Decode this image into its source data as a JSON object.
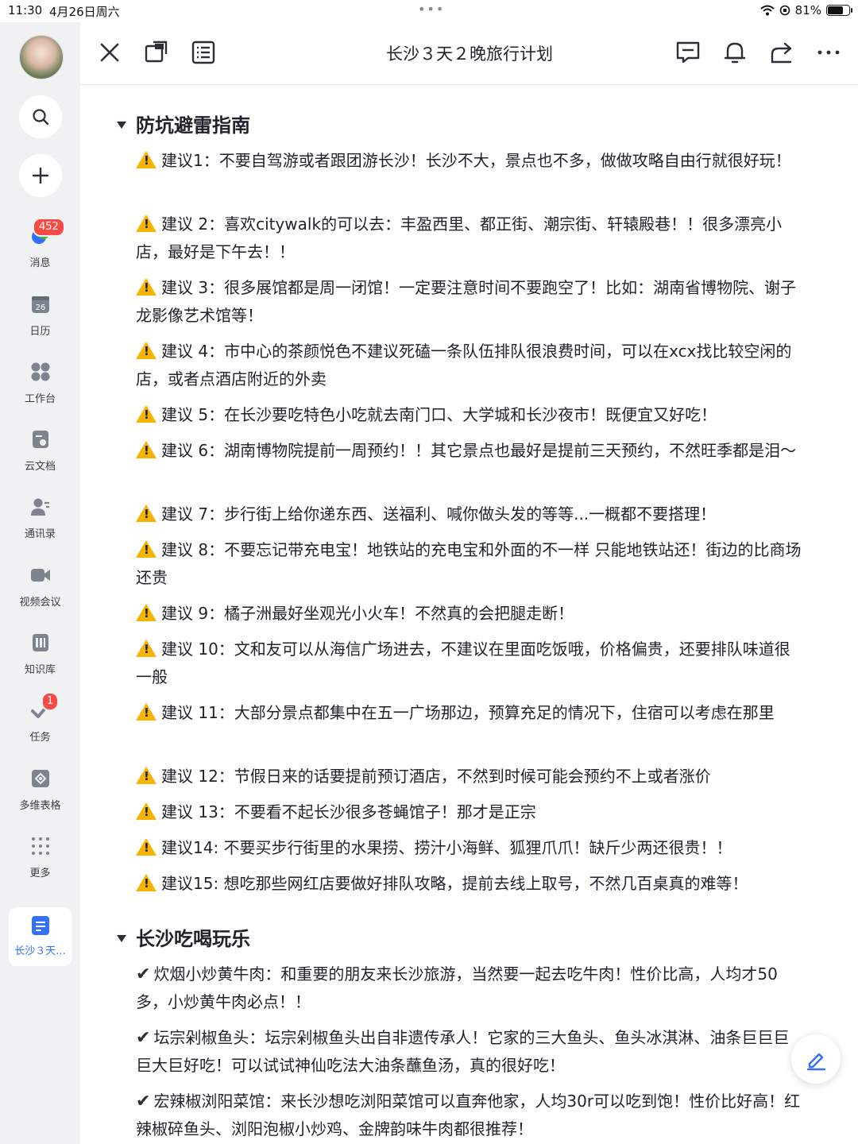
{
  "status_bar": {
    "time": "11:30",
    "date": "4月26日周六",
    "battery": "81%",
    "battery_level": 0.81
  },
  "sidebar": {
    "search_icon": "search-icon",
    "add_icon": "plus-icon",
    "items": [
      {
        "label": "消息",
        "icon": "message-icon",
        "badge": "452"
      },
      {
        "label": "日历",
        "icon": "calendar-icon",
        "icon_text": "26"
      },
      {
        "label": "工作台",
        "icon": "workspace-icon"
      },
      {
        "label": "云文档",
        "icon": "cloud-doc-icon"
      },
      {
        "label": "通讯录",
        "icon": "contacts-icon"
      },
      {
        "label": "视频会议",
        "icon": "video-icon"
      },
      {
        "label": "知识库",
        "icon": "wiki-icon"
      },
      {
        "label": "任务",
        "icon": "task-icon",
        "badge": "1"
      },
      {
        "label": "多维表格",
        "icon": "base-icon"
      },
      {
        "label": "更多",
        "icon": "more-grid-icon"
      }
    ],
    "active_doc_label": "长沙３天..."
  },
  "header": {
    "title": "长沙３天２晚旅行计划"
  },
  "sections": [
    {
      "heading": "防坑避雷指南",
      "paragraphs": [
        "建议1：不要自驾游或者跟团游长沙！长沙不大，景点也不多，做做攻略自由行就很好玩！",
        "建议 2：喜欢citywalk的可以去：丰盈西里、都正街、潮宗街、轩辕殿巷！！很多漂亮小店，最好是下午去！！",
        "建议 3：很多展馆都是周一闭馆！一定要注意时间不要跑空了！比如：湖南省博物院、谢子龙影像艺术馆等！",
        "建议 4：市中心的茶颜悦色不建议死磕一条队伍排队很浪费时间，可以在xcx找比较空闲的店，或者点酒店附近的外卖",
        "建议 5：在长沙要吃特色小吃就去南门口、大学城和长沙夜市！既便宜又好吃！",
        "建议 6：湖南博物院提前一周预约！！其它景点也最好是提前三天预约，不然旺季都是泪～",
        "建议 7：步行街上给你递东西、送福利、喊你做头发的等等...一概都不要搭理！",
        "建议 8：不要忘记带充电宝！地铁站的充电宝和外面的不一样 只能地铁站还！街边的比商场还贵",
        "建议 9：橘子洲最好坐观光小火车！不然真的会把腿走断！",
        "建议 10：文和友可以从海信广场进去，不建议在里面吃饭哦，价格偏贵，还要排队味道很一般",
        "建议 11：大部分景点都集中在五一广场那边，预算充足的情况下，住宿可以考虑在那里",
        "建议 12：节假日来的话要提前预订酒店，不然到时候可能会预约不上或者涨价",
        "建议 13：不要看不起长沙很多苍蝇馆子！那才是正宗",
        "建议14: 不要买步行街里的水果捞、捞汁小海鲜、狐狸爪爪！缺斤少两还很贵！！",
        "建议15: 想吃那些网红店要做好排队攻略，提前去线上取号，不然几百桌真的难等！"
      ]
    },
    {
      "heading": "长沙吃喝玩乐",
      "paragraphs": [
        "炊烟小炒黄牛肉：和重要的朋友来长沙旅游，当然要一起去吃牛肉！性价比高，人均才50多，小炒黄牛肉必点！！",
        "坛宗剁椒鱼头：坛宗剁椒鱼头出自非遗传承人！它家的三大鱼头、鱼头冰淇淋、油条巨巨巨巨大巨好吃！可以试试神仙吃法大油条蘸鱼汤，真的很好吃！",
        "宏辣椒浏阳菜馆：来长沙想吃浏阳菜馆可以直奔他家，人均30r可以吃到饱！性价比好高！红辣椒碎鱼头、浏阳泡椒小炒鸡、金牌韵味牛肉都很推荐！"
      ]
    }
  ]
}
